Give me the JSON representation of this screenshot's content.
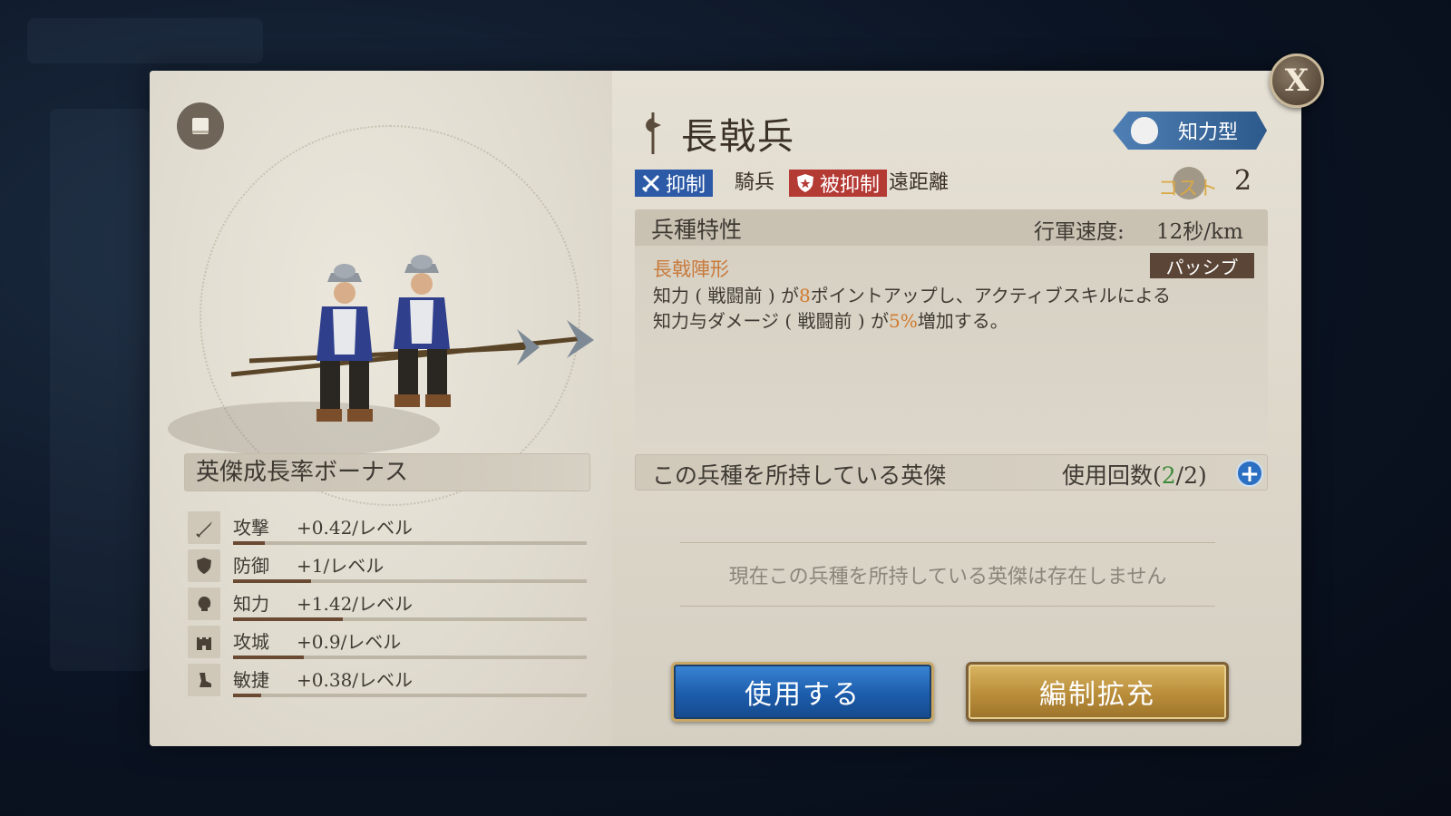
{
  "modal": {
    "close_label": "X"
  },
  "unit": {
    "name": "長戟兵",
    "type_badge": "知力型"
  },
  "matchup": {
    "suppress_label": "抑制",
    "suppress_target": "騎兵",
    "suppressed_label": "被抑制",
    "suppressed_target": "遠距離"
  },
  "cost": {
    "label": "コスト",
    "value": "2"
  },
  "traits": {
    "title": "兵種特性",
    "march_label": "行軍速度:",
    "march_value": "12秒/km",
    "skill_name": "長戟陣形",
    "skill_type": "パッシブ",
    "desc_1a": "知力 ( 戦闘前 ) が",
    "desc_1b": "8",
    "desc_1c": "ポイントアップし、アクティブスキルによる",
    "desc_2a": "知力与ダメージ ( 戦闘前 ) が",
    "desc_2b": "5%",
    "desc_2c": "増加する。"
  },
  "growth": {
    "title": "英傑成長率ボーナス",
    "stats": [
      {
        "name": "攻撃",
        "value": "+0.42/レベル",
        "fill": 0.09,
        "icon": "sword-icon"
      },
      {
        "name": "防御",
        "value": "+1/レベル",
        "fill": 0.22,
        "icon": "shield-icon"
      },
      {
        "name": "知力",
        "value": "+1.42/レベル",
        "fill": 0.31,
        "icon": "head-icon"
      },
      {
        "name": "攻城",
        "value": "+0.9/レベル",
        "fill": 0.2,
        "icon": "castle-icon"
      },
      {
        "name": "敏捷",
        "value": "+0.38/レベル",
        "fill": 0.08,
        "icon": "boot-icon"
      }
    ]
  },
  "heroes": {
    "title": "この兵種を所持している英傑",
    "usage_prefix": "使用回数(",
    "usage_current": "2",
    "usage_suffix": "/2)",
    "empty_text": "現在この兵種を所持している英傑は存在しません"
  },
  "buttons": {
    "use": "使用する",
    "expand": "編制拡充"
  },
  "colors": {
    "accent_blue": "#2c5aa6",
    "accent_red": "#b43a34",
    "highlight_orange": "#d07a2c",
    "cost_gold": "#d9a844",
    "usage_green": "#3f8a3a"
  }
}
